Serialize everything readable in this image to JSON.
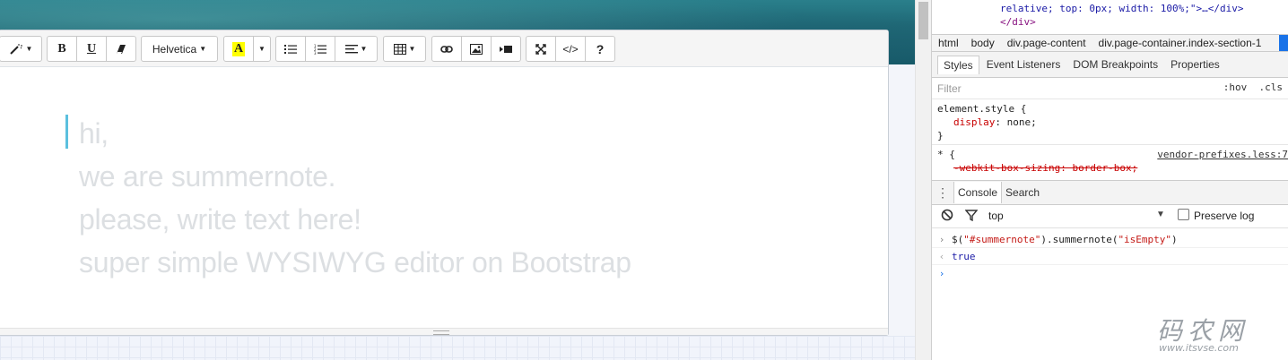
{
  "editor": {
    "toolbar": {
      "font_name": "Helvetica",
      "bold": "B",
      "underline": "U",
      "highlight": "A",
      "help": "?",
      "code_view": "</>"
    },
    "placeholder_lines": [
      "hi,",
      "we are summernote.",
      "please, write text here!",
      "super simple WYSIWYG editor on Bootstrap"
    ]
  },
  "devtools": {
    "dom_lines": [
      "relative; top: 0px; width: 100%;\">…</div>",
      "</div>"
    ],
    "breadcrumbs": [
      "html",
      "body",
      "div.page-content",
      "div.page-container.index-section-1"
    ],
    "tabs": [
      "Styles",
      "Event Listeners",
      "DOM Breakpoints",
      "Properties"
    ],
    "filter_placeholder": "Filter",
    "filter_hov": ":hov",
    "filter_cls": ".cls",
    "styles": {
      "element_style_selector": "element.style {",
      "element_style_prop": "display",
      "element_style_value": "none;",
      "close_brace": "}",
      "universal_selector": "* {",
      "source_link": "vendor-prefixes.less:7",
      "struck_prop": "-webkit-box-sizing: border-box;"
    },
    "console_tabs": [
      "Console",
      "Search"
    ],
    "context": "top",
    "preserve_log": "Preserve log",
    "console": {
      "input_prefix": "$(",
      "input_selector": "\"#summernote\"",
      "input_middle": ").summernote(",
      "input_arg": "\"isEmpty\"",
      "input_suffix": ")",
      "output": "true"
    }
  },
  "watermark": {
    "text": "码农网",
    "url": "www.itsvse.com"
  }
}
